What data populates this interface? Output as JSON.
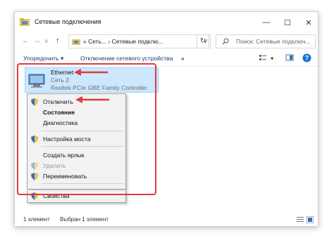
{
  "window": {
    "title": "Сетевые подключения",
    "controls": {
      "minimize": "—",
      "maximize": "☐",
      "close": "✕"
    }
  },
  "address": {
    "path": "« Сеть... › Сетевые подклю...",
    "search_placeholder": "Поиск: Сетевые подключ..."
  },
  "toolbar": {
    "organize": "Упорядочить ▾",
    "disable_device": "Отключение сетевого устройства",
    "more": "»"
  },
  "connection": {
    "name": "Ethernet",
    "network": "Сеть  2",
    "adapter": "Realtek PCIe GBE Family Controller"
  },
  "context_menu": {
    "items": [
      {
        "label": "Отключить",
        "shield": true
      },
      {
        "label": "Состояние",
        "bold": true
      },
      {
        "label": "Диагностика"
      },
      {
        "label": "Настройка моста",
        "shield": true
      },
      {
        "label": "Создать ярлык"
      },
      {
        "label": "Удалить",
        "shield": true,
        "disabled": true
      },
      {
        "label": "Переименовать",
        "shield": true
      },
      {
        "label": "Свойства",
        "shield": true
      }
    ]
  },
  "status": {
    "count": "1 элемент",
    "selected": "Выбран 1 элемент"
  },
  "colors": {
    "highlight": "#e0393e",
    "selection": "#cce8ff",
    "link": "#1a3d6e"
  }
}
